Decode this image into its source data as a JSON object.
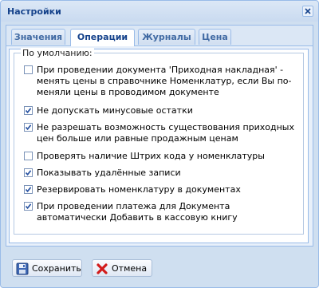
{
  "window": {
    "title": "Настройки"
  },
  "tabs": [
    {
      "label": "Значения",
      "active": false
    },
    {
      "label": "Операции",
      "active": true
    },
    {
      "label": "Журналы",
      "active": false
    },
    {
      "label": "Цена",
      "active": false
    }
  ],
  "group": {
    "legend": "По умолчанию:",
    "options": [
      {
        "label": "При проведении документа 'Приходная накладная' - менять цены в справочнике Номенклатур, если Вы по-меняли цены в проводимом документе",
        "checked": false
      },
      {
        "label": "Не допускать минусовые остатки",
        "checked": true
      },
      {
        "label": "Не разрешать возможность существования приходных цен больше или равные продажным ценам",
        "checked": true
      },
      {
        "label": "Проверять наличие Штрих кода у номенклатуры",
        "checked": false
      },
      {
        "label": "Показывать удалённые записи",
        "checked": true
      },
      {
        "label": "Резервировать номенклатуру в документах",
        "checked": true
      },
      {
        "label": "При проведении платежа для Документа автоматически Добавить в кассовую книгу",
        "checked": true
      }
    ]
  },
  "buttons": {
    "save": "Сохранить",
    "cancel": "Отмена"
  },
  "colors": {
    "accent": "#15428b",
    "border": "#99bbe8",
    "check": "#2b55a3"
  },
  "icons": {
    "close": "close-icon",
    "save": "floppy-disk-icon",
    "cancel": "red-x-icon"
  }
}
